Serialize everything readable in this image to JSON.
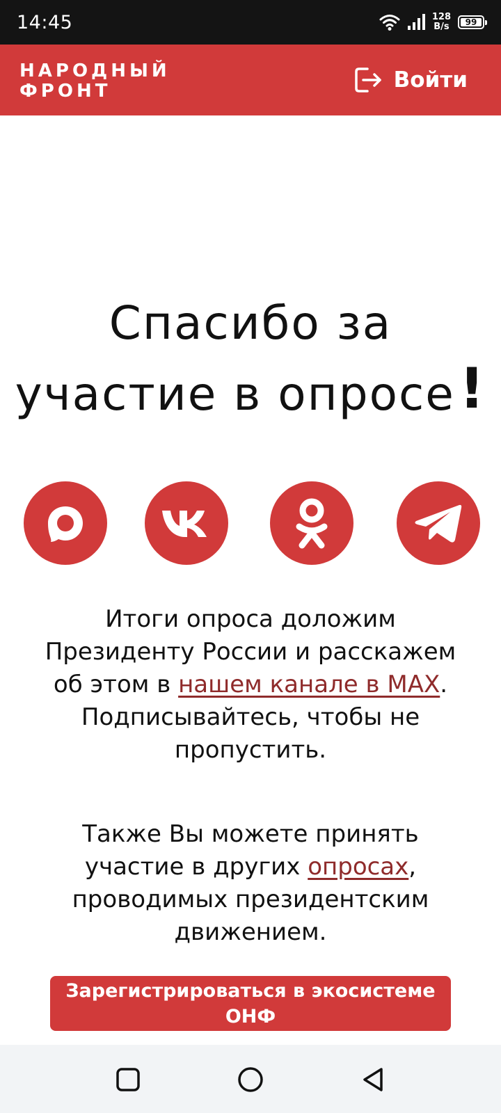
{
  "status_bar": {
    "time": "14:45",
    "net_speed_value": "128",
    "net_speed_unit": "B/s",
    "battery": "99",
    "icons": [
      "wifi-icon",
      "signal-icon",
      "battery-icon"
    ]
  },
  "header": {
    "logo_line1": "НАРОДНЫЙ",
    "logo_line2": "ФРОНТ",
    "login_label": "Войти",
    "login_icon": "logout-arrow-icon",
    "background": "#d13a3a"
  },
  "main": {
    "title_line1": "Спасибо за",
    "title_line2": "участие в опросе",
    "title_mark": "!",
    "social": [
      {
        "name": "max-icon"
      },
      {
        "name": "vk-icon"
      },
      {
        "name": "odnoklassniki-icon"
      },
      {
        "name": "telegram-icon"
      }
    ],
    "results": {
      "text_before": "Итоги опроса доложим Президенту России и расскажем об этом в ",
      "link": "нашем канале в MAX",
      "text_after": ". Подписывайтесь, чтобы не пропустить."
    },
    "other": {
      "text_before": "Также Вы можете принять участие в других ",
      "link": "опросах",
      "text_after": ", проводимых президентским движением."
    },
    "register_button": "Зарегистрироваться в экосистеме ОНФ",
    "accent_color": "#d13a3a",
    "link_color": "#8f2b2b"
  },
  "nav_bar": {
    "buttons": [
      "square-recents-icon",
      "circle-home-icon",
      "triangle-back-icon"
    ]
  }
}
